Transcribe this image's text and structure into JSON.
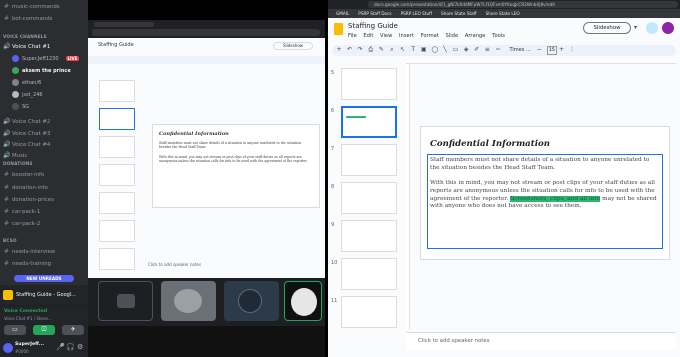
{
  "discord": {
    "channels_top": [
      {
        "label": "music-commands",
        "icon": "hash"
      },
      {
        "label": "bot-commands",
        "icon": "hash"
      }
    ],
    "voice_category": "VOICE CHANNELS",
    "voice_chat_1": "Voice Chat #1",
    "users": [
      {
        "name": "Super.Jeff1230",
        "live": "LIVE"
      },
      {
        "name": "aksem the prince"
      },
      {
        "name": "ethan/6"
      },
      {
        "name": "jsst_246"
      },
      {
        "name": "SG"
      }
    ],
    "voice_channels": [
      "Voice Chat #2",
      "Voice Chat #3",
      "Voice Chat #4",
      "Music"
    ],
    "donations_category": "DONATIONS",
    "donation_channels": [
      "booster-info",
      "donation-info",
      "donation-prices",
      "car-pack-1",
      "car-pack-2"
    ],
    "bcso_category": "BCSO",
    "bcso_channels": [
      "needs-interview",
      "needs-training"
    ],
    "new_unreads": "NEW UNREADS",
    "stream_title": "Staffing Guide - Googl...",
    "voice_connected": "Voice Connected",
    "voice_connected_sub": "Voice Chat #1 / Shore...",
    "self_user": "SuperJeff...",
    "self_tag": "#0000"
  },
  "browser": {
    "url": "docs.google.com/presentation/d/1_gNl7k0ddMFpW7Lf1QFxm0YKoqJcCR2WnbXJ8v/edit",
    "bookmarks": [
      "GMAIL",
      "PSRP Staff Docs",
      "PSRP LEO Stuff",
      "Shore State Staff",
      "Shore State LEO"
    ]
  },
  "slides": {
    "title": "Staffing Guide",
    "menu": [
      "File",
      "Edit",
      "View",
      "Insert",
      "Format",
      "Slide",
      "Arrange",
      "Tools"
    ],
    "slideshow": "Slideshow",
    "font": "Times ...",
    "font_size": "15",
    "slide_numbers": [
      "5",
      "6",
      "7",
      "8",
      "9",
      "10",
      "11"
    ],
    "heading": "Confidential Information",
    "para1": "Staff members must not share details of a situation to anyone unrelated to the situation besides the Head Staff Team.",
    "para2_a": "With this in mind, you may not stream or post clips of your staff duties as all reports are anonymous unless the situation calls for info to be used with the agreement of the reporter.",
    "para2_highlight": "Screenshots, clips, and all info",
    "para2_b": "may not be shared with anyone who does not have access to see them.",
    "speaker_notes": "Click to add speaker notes",
    "colors": {
      "accent": "#1a73e8",
      "highlight": "#2bb673",
      "discord_bg": "#2b2d31"
    }
  }
}
